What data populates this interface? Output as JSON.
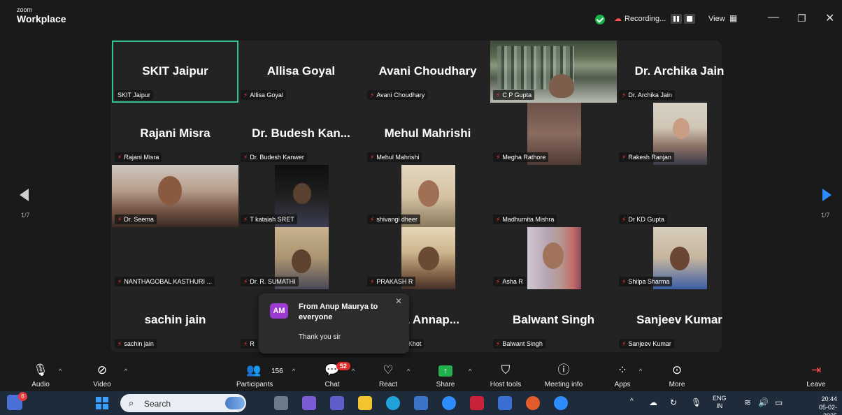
{
  "titlebar": {
    "brand_top": "zoom",
    "brand_bottom": "Workplace",
    "recording_label": "Recording...",
    "view_label": "View"
  },
  "gallery": {
    "page_left": "1/7",
    "page_right": "1/7",
    "tiles": [
      {
        "name": "SKIT Jaipur",
        "big": "SKIT Jaipur",
        "video": null,
        "muted": false,
        "active": true
      },
      {
        "name": "Allisa Goyal",
        "big": "Allisa Goyal",
        "video": null,
        "muted": true
      },
      {
        "name": "Avani Choudhary",
        "big": "Avani Choudhary",
        "video": null,
        "muted": true
      },
      {
        "name": "C P Gupta",
        "big": "",
        "video": "library",
        "muted": true
      },
      {
        "name": "Dr. Archika Jain",
        "big": "Dr. Archika Jain",
        "video": null,
        "muted": true
      },
      {
        "name": "Rajani Misra",
        "big": "Rajani Misra",
        "video": null,
        "muted": true
      },
      {
        "name": "Dr. Budesh Kanwer",
        "big": "Dr. Budesh Kan...",
        "video": null,
        "muted": true
      },
      {
        "name": "Mehul Mahrishi",
        "big": "Mehul Mahrishi",
        "video": null,
        "muted": true
      },
      {
        "name": "Megha Rathore",
        "big": "",
        "video": "megha",
        "muted": true
      },
      {
        "name": "Rakesh Ranjan",
        "big": "",
        "video": "rakesh",
        "muted": true
      },
      {
        "name": "Dr. Seema",
        "big": "",
        "video": "seema",
        "muted": true
      },
      {
        "name": "T kataiah SRET",
        "big": "",
        "video": "kataiah",
        "muted": true
      },
      {
        "name": "shivangi dheer",
        "big": "",
        "video": "shivangi",
        "muted": true
      },
      {
        "name": "Madhumita Mishra",
        "big": "",
        "video": null,
        "muted": true
      },
      {
        "name": "Dr KD Gupta",
        "big": "",
        "video": null,
        "muted": true
      },
      {
        "name": "NANTHAGOBAL KASTHURI ...",
        "big": "",
        "video": null,
        "muted": true
      },
      {
        "name": "Dr. R. SUMATHI",
        "big": "",
        "video": "sumathi",
        "muted": true
      },
      {
        "name": "PRAKASH R",
        "big": "",
        "video": "prakash",
        "muted": true
      },
      {
        "name": "Asha R",
        "big": "",
        "video": "asha",
        "muted": true
      },
      {
        "name": "Shilpa Sharma",
        "big": "",
        "video": "shilpa",
        "muted": true
      },
      {
        "name": "sachin jain",
        "big": "sachin jain",
        "video": null,
        "muted": true
      },
      {
        "name": "R",
        "big": "R.",
        "video": null,
        "muted": true
      },
      {
        "name": "a Annappa Khot",
        "big": "ha  Annap...",
        "video": null,
        "muted": true
      },
      {
        "name": "Balwant Singh",
        "big": "Balwant Singh",
        "video": null,
        "muted": true
      },
      {
        "name": "Sanjeev Kumar",
        "big": "Sanjeev Kumar",
        "video": null,
        "muted": true
      }
    ]
  },
  "chat_popup": {
    "avatar": "AM",
    "from": "From Anup Maurya to everyone",
    "message": "Thank you sir"
  },
  "toolbar": {
    "audio": "Audio",
    "video": "Video",
    "participants": "Participants",
    "participants_count": "156",
    "chat": "Chat",
    "chat_badge": "52",
    "react": "React",
    "share": "Share",
    "host_tools": "Host tools",
    "meeting_info": "Meeting info",
    "apps": "Apps",
    "more": "More",
    "leave": "Leave"
  },
  "taskbar": {
    "teams_badge": "6",
    "search_placeholder": "Search",
    "lang_top": "ENG",
    "lang_bottom": "IN",
    "time": "20:44",
    "date": "05-02-2025"
  }
}
